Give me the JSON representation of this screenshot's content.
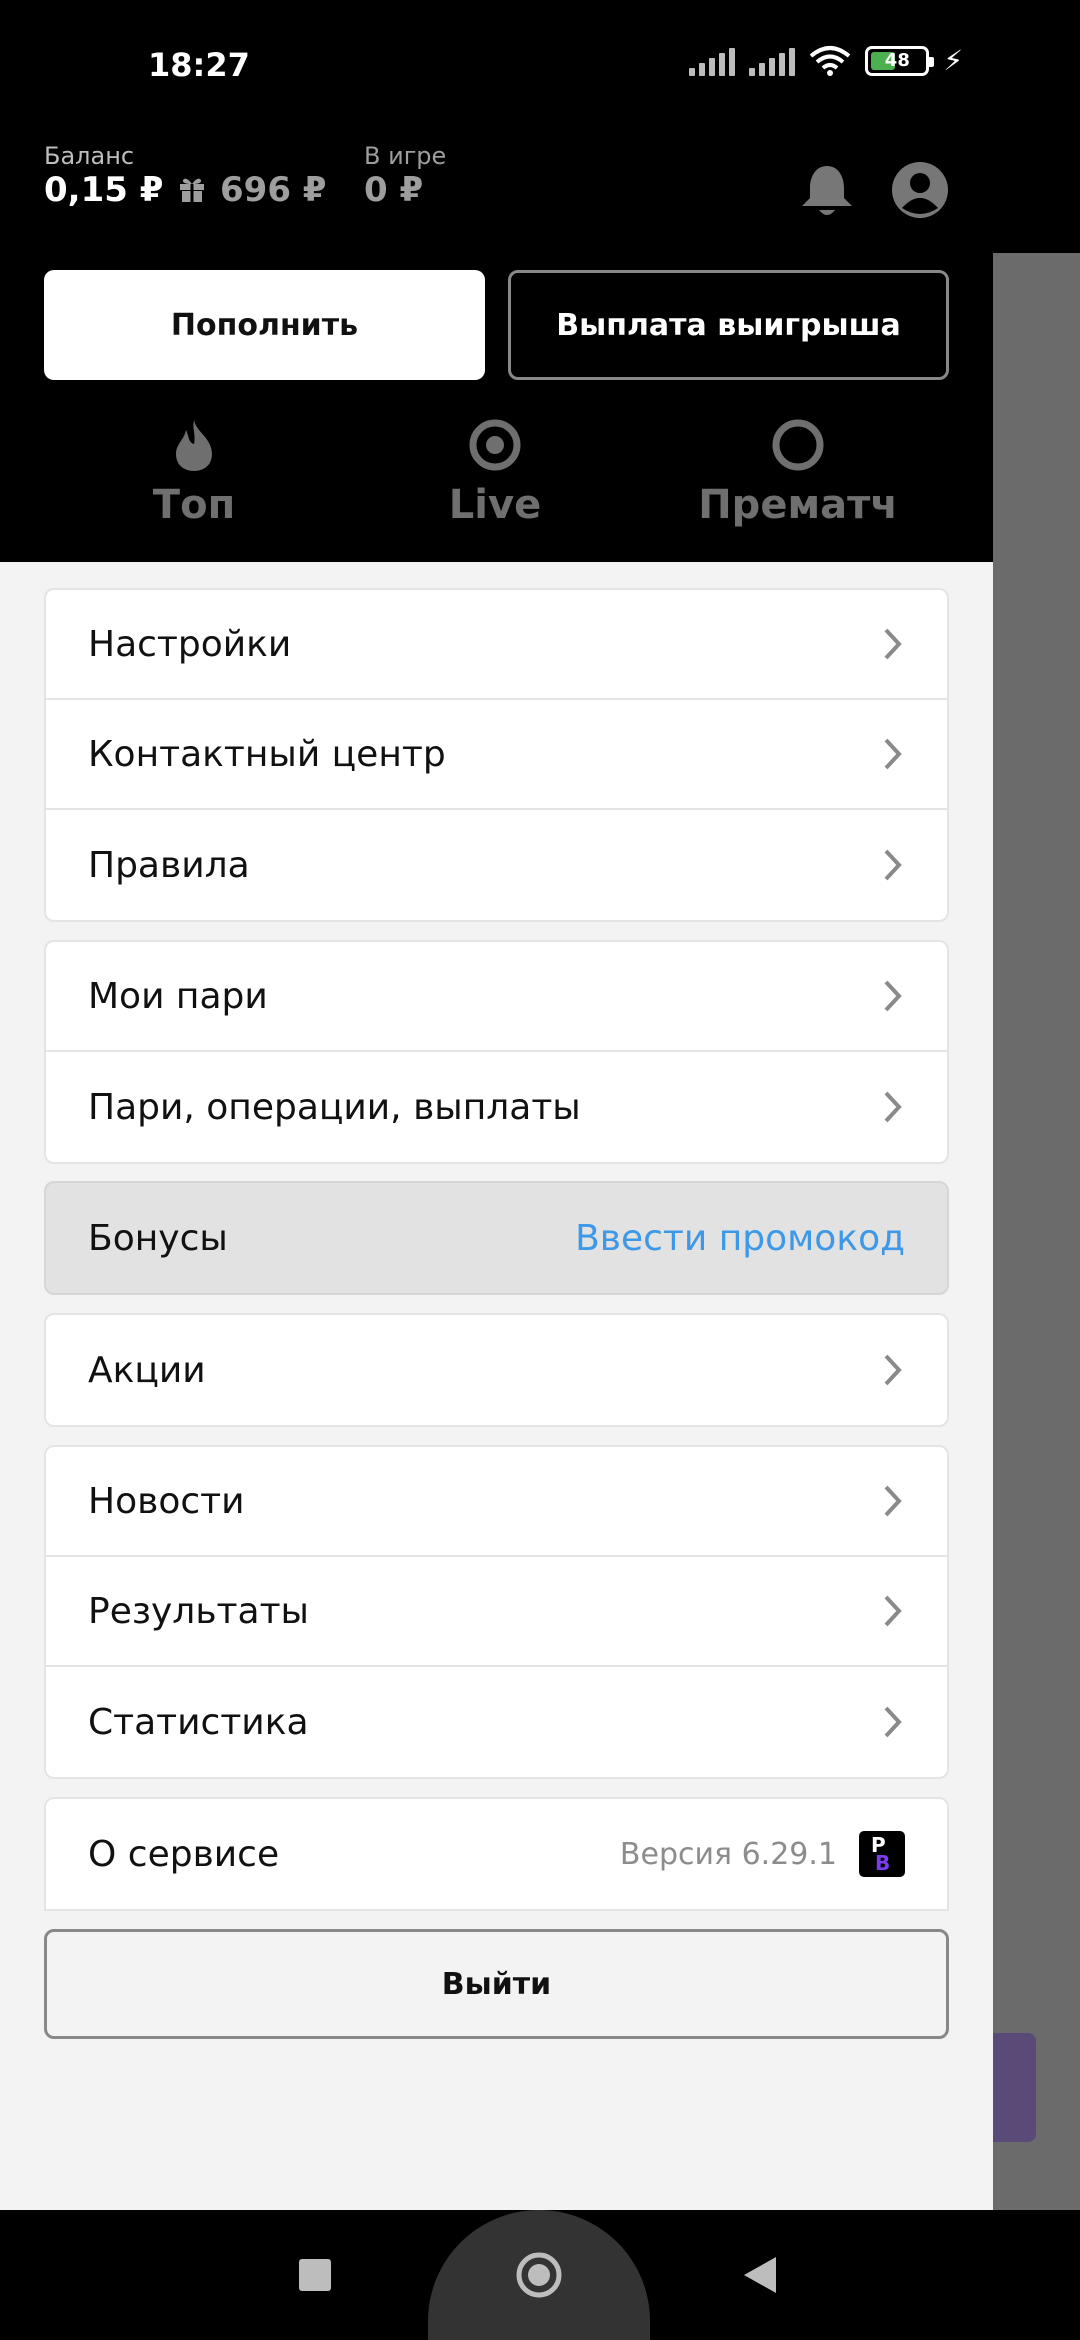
{
  "status_bar": {
    "time": "18:27",
    "battery": "48"
  },
  "balance": {
    "label": "Баланс",
    "value": "0,15 ₽",
    "bonus_value": "696 ₽",
    "in_game_label": "В игре",
    "in_game_value": "0 ₽"
  },
  "buttons": {
    "deposit": "Пополнить",
    "payout": "Выплата выигрыша",
    "logout": "Выйти"
  },
  "tabs": [
    {
      "label": "Топ",
      "icon": "flame-icon"
    },
    {
      "label": "Live",
      "icon": "live-icon"
    },
    {
      "label": "Прематч",
      "icon": "ring-icon"
    }
  ],
  "menu": {
    "group1": [
      {
        "label": "Настройки"
      },
      {
        "label": "Контактный центр"
      },
      {
        "label": "Правила"
      }
    ],
    "group2": [
      {
        "label": "Мои пари"
      },
      {
        "label": "Пари, операции, выплаты"
      }
    ],
    "bonuses": {
      "label": "Бонусы",
      "action": "Ввести промокод"
    },
    "group3": [
      {
        "label": "Акции"
      }
    ],
    "group4": [
      {
        "label": "Новости"
      },
      {
        "label": "Результаты"
      },
      {
        "label": "Статистика"
      }
    ],
    "about": {
      "label": "О сервисе",
      "version": "Версия 6.29.1",
      "logo_p": "P",
      "logo_b": "B"
    }
  },
  "colors": {
    "accent_blue": "#3d98e8",
    "drawer_bg": "#f3f3f3",
    "header_bg": "#000000"
  }
}
